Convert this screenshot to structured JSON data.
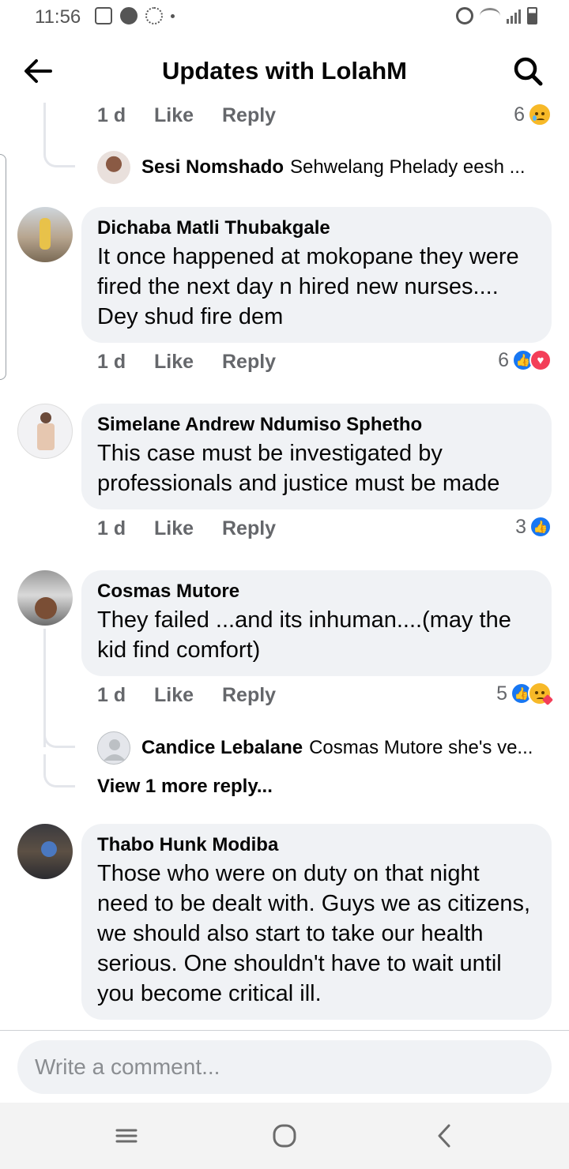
{
  "status_bar": {
    "time": "11:56"
  },
  "header": {
    "title": "Updates with LolahM",
    "back_icon": "arrow-left-icon",
    "search_icon": "search-icon"
  },
  "top_actions": {
    "time": "1 d",
    "like": "Like",
    "reply": "Reply",
    "reaction_count": "6",
    "reactions": [
      "sad"
    ]
  },
  "top_reply": {
    "name": "Sesi Nomshado",
    "text": "Sehwelang Phelady eesh ..."
  },
  "comments": [
    {
      "author": "Dichaba Matli Thubakgale",
      "text": "It once happened at mokopane they were fired the next day n hired new nurses.... Dey shud fire dem",
      "time": "1 d",
      "like": "Like",
      "reply": "Reply",
      "reaction_count": "6",
      "reactions": [
        "like",
        "love"
      ]
    },
    {
      "author": "Simelane Andrew Ndumiso Sphetho",
      "text": "This case must be investigated by professionals and justice must be made",
      "time": "1 d",
      "like": "Like",
      "reply": "Reply",
      "reaction_count": "3",
      "reactions": [
        "like"
      ]
    },
    {
      "author": "Cosmas Mutore",
      "text": "They failed ...and its inhuman....(may the kid find comfort)",
      "time": "1 d",
      "like": "Like",
      "reply": "Reply",
      "reaction_count": "5",
      "reactions": [
        "like",
        "care"
      ],
      "reply_preview": {
        "name": "Candice Lebalane",
        "text": "Cosmas Mutore she's ve..."
      },
      "view_more": "View 1 more reply..."
    },
    {
      "author": "Thabo Hunk Modiba",
      "text": "Those who were on duty on that night need to be dealt with. Guys we as citizens, we should also start to take our health serious. One shouldn't have to wait until you become critical ill."
    }
  ],
  "composer": {
    "placeholder": "Write a comment..."
  },
  "colors": {
    "like_blue": "#1877f2",
    "love_red": "#f33e58",
    "bubble_bg": "#f0f2f5",
    "meta_gray": "#65676b"
  }
}
